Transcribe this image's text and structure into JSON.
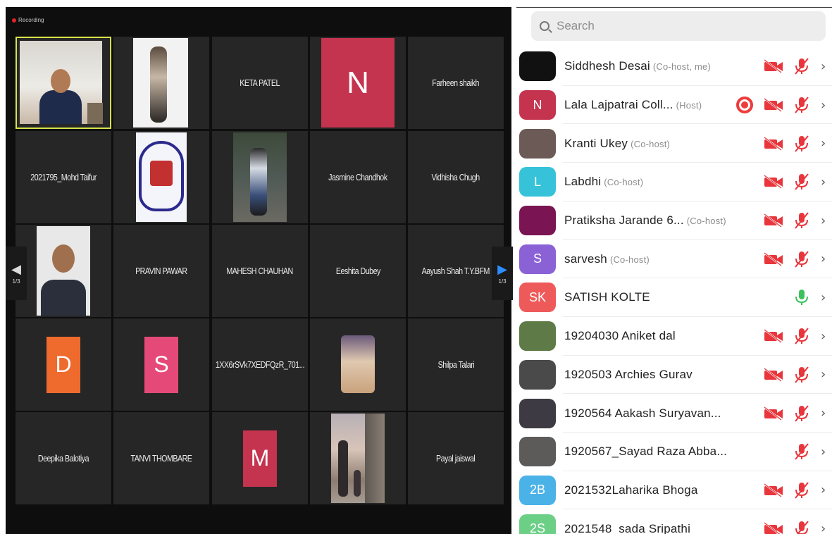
{
  "recording": {
    "label": "Recording"
  },
  "gallery": {
    "tiles": [
      {
        "name": "",
        "type": "photo"
      },
      {
        "name": "",
        "type": "photo"
      },
      {
        "name": "KETA PATEL",
        "type": "name"
      },
      {
        "name": "N",
        "type": "letter",
        "color": "#c4344f"
      },
      {
        "name": "Farheen shaikh",
        "type": "name"
      },
      {
        "name": "2021795_Mohd Taifur",
        "type": "name"
      },
      {
        "name": "",
        "type": "photo"
      },
      {
        "name": "",
        "type": "photo"
      },
      {
        "name": "Jasmine Chandhok",
        "type": "name"
      },
      {
        "name": "Vidhisha Chugh",
        "type": "name"
      },
      {
        "name": "",
        "type": "photo"
      },
      {
        "name": "PRAVIN PAWAR",
        "type": "name"
      },
      {
        "name": "MAHESH CHAUHAN",
        "type": "name"
      },
      {
        "name": "Eeshita Dubey",
        "type": "name"
      },
      {
        "name": "Aayush Shah T.Y.BFM",
        "type": "name"
      },
      {
        "name": "D",
        "type": "letter",
        "color": "#ee6a2d"
      },
      {
        "name": "S",
        "type": "letter",
        "color": "#e54978"
      },
      {
        "name": "1XX6rSVk7XEDFQzR_701...",
        "type": "name"
      },
      {
        "name": "",
        "type": "photo"
      },
      {
        "name": "Shilpa Talari",
        "type": "name"
      },
      {
        "name": "Deepika Balotiya",
        "type": "name"
      },
      {
        "name": "TANVI THOMBARE",
        "type": "name"
      },
      {
        "name": "M",
        "type": "letter",
        "color": "#c4344f"
      },
      {
        "name": "",
        "type": "photo"
      },
      {
        "name": "Payal jaiswal",
        "type": "name"
      }
    ],
    "nav_left_page": "1/3",
    "nav_right_page": "1/3"
  },
  "search": {
    "placeholder": "Search"
  },
  "participants": [
    {
      "name": "Siddhesh Desai",
      "role": "(Co-host, me)",
      "avatar": "",
      "avatar_color": "#111111",
      "recording": false,
      "video_off": true,
      "muted": true
    },
    {
      "name": "Lala Lajpatrai Coll...",
      "role": "(Host)",
      "avatar": "N",
      "avatar_color": "#c4344f",
      "recording": true,
      "video_off": true,
      "muted": true
    },
    {
      "name": "Kranti Ukey",
      "role": "(Co-host)",
      "avatar": "",
      "avatar_color": "#6b5a55",
      "recording": false,
      "video_off": true,
      "muted": true
    },
    {
      "name": "Labdhi",
      "role": "(Co-host)",
      "avatar": "L",
      "avatar_color": "#36c2d8",
      "recording": false,
      "video_off": true,
      "muted": true
    },
    {
      "name": "Pratiksha Jarande 6...",
      "role": "(Co-host)",
      "avatar": "",
      "avatar_color": "#7a1452",
      "recording": false,
      "video_off": true,
      "muted": true
    },
    {
      "name": "sarvesh",
      "role": "(Co-host)",
      "avatar": "S",
      "avatar_color": "#8a62d6",
      "recording": false,
      "video_off": true,
      "muted": true
    },
    {
      "name": "SATISH KOLTE",
      "role": "",
      "avatar": "SK",
      "avatar_color": "#ee5a5a",
      "recording": false,
      "video_off": false,
      "muted": false
    },
    {
      "name": "19204030 Aniket dal",
      "role": "",
      "avatar": "",
      "avatar_color": "#5e7a46",
      "recording": false,
      "video_off": true,
      "muted": true
    },
    {
      "name": "1920503 Archies Gurav",
      "role": "",
      "avatar": "",
      "avatar_color": "#4a4a4a",
      "recording": false,
      "video_off": true,
      "muted": true
    },
    {
      "name": "1920564 Aakash Suryavan...",
      "role": "",
      "avatar": "",
      "avatar_color": "#3e3a44",
      "recording": false,
      "video_off": true,
      "muted": true
    },
    {
      "name": "1920567_Sayad Raza Abba...",
      "role": "",
      "avatar": "",
      "avatar_color": "#5d5a5a",
      "recording": false,
      "video_off": false,
      "muted": true
    },
    {
      "name": "2021532Laharika Bhoga",
      "role": "",
      "avatar": "2B",
      "avatar_color": "#4bb2e8",
      "recording": false,
      "video_off": true,
      "muted": true
    },
    {
      "name": "2021548_sada Sripathi",
      "role": "",
      "avatar": "2S",
      "avatar_color": "#6ccf86",
      "recording": false,
      "video_off": true,
      "muted": true
    }
  ],
  "colors": {
    "muted_red": "#e8363c",
    "unmuted_green": "#3cc25a",
    "active_border": "#d8e24a",
    "accent_blue": "#2d8cff"
  },
  "icons": {
    "search": "search-icon",
    "video_off": "video-off-icon",
    "mic_muted": "mic-muted-icon",
    "mic_on": "mic-icon",
    "chevron": "chevron-right-icon",
    "record": "record-icon"
  }
}
